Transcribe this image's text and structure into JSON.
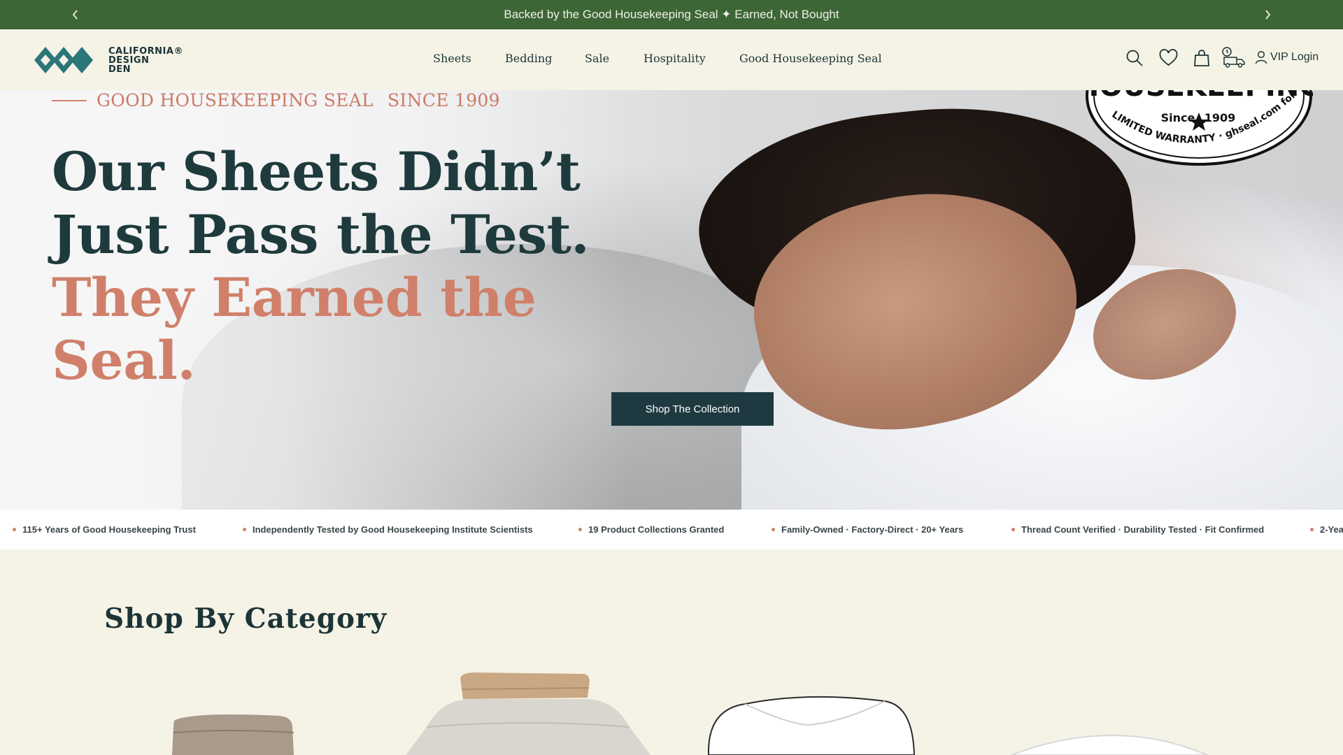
{
  "announcement": {
    "text": "Backed by the Good Housekeeping Seal ✦ Earned, Not Bought"
  },
  "brand": {
    "line1": "CALIFORNIA®",
    "line2": "DESIGN",
    "line3": "DEN"
  },
  "nav": {
    "items": [
      "Sheets",
      "Bedding",
      "Sale",
      "Hospitality",
      "Good Housekeeping Seal"
    ]
  },
  "header": {
    "vip_login": "VIP Login"
  },
  "hero": {
    "eyebrow_seal": "GOOD HOUSEKEEPING SEAL",
    "eyebrow_since": "SINCE 1909",
    "title_line1": "Our Sheets Didn’t",
    "title_line2": "Just Pass the Test.",
    "title_line3": "They Earned the",
    "title_line4": "Seal.",
    "cta": "Shop The Collection",
    "seal_word": "HOUSEKEEPING",
    "seal_since": "Since",
    "seal_year": "1909",
    "seal_warranty": "LIMITED WARRANTY · ghseal.com for details"
  },
  "trust": {
    "items": [
      "115+ Years of Good Housekeeping Trust",
      "Independently Tested by Good Housekeeping Institute Scientists",
      "19 Product Collections Granted",
      "Family-Owned · Factory-Direct · 20+ Years",
      "Thread Count Verified · Durability Tested · Fit Confirmed",
      "2-Yea"
    ]
  },
  "category": {
    "title": "Shop By Category"
  },
  "colors": {
    "announce": "#3d6636",
    "accent": "#d0806a",
    "dark": "#1f3a3c",
    "cta": "#1e3a40",
    "bg": "#f5f3e6"
  }
}
